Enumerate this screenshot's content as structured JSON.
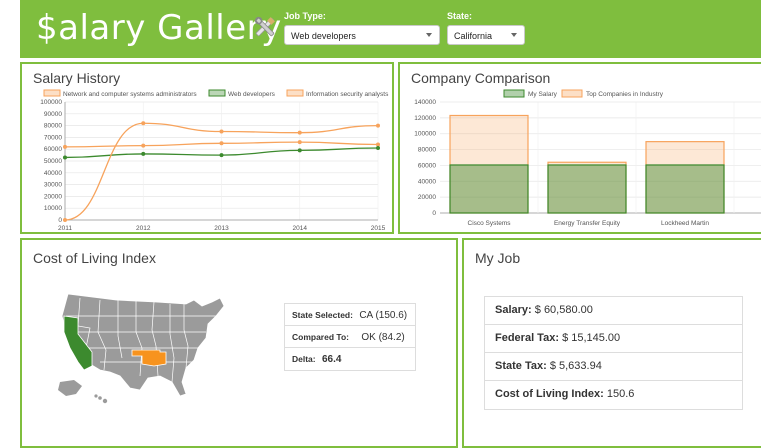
{
  "header": {
    "logo": "$alary Gallery",
    "job_type_label": "Job Type:",
    "job_type_value": "Web developers",
    "state_label": "State:",
    "state_value": "California"
  },
  "salary_history": {
    "title": "Salary History",
    "chart_data": {
      "type": "line",
      "x": [
        "2011",
        "2012",
        "2013",
        "2014",
        "2015"
      ],
      "ylim": [
        0,
        100000
      ],
      "yticks": [
        "100000",
        "90000",
        "80000",
        "70000",
        "60000",
        "50000",
        "40000",
        "30000",
        "20000",
        "10000",
        "0"
      ],
      "series": [
        {
          "name": "Network and computer systems administrators",
          "values": [
            62000,
            63000,
            65000,
            66000,
            64000
          ],
          "color": "#f7a35c"
        },
        {
          "name": "Web developers",
          "values": [
            53000,
            56000,
            55000,
            59000,
            61000
          ],
          "color": "#3c8a2e"
        },
        {
          "name": "Information security analysts",
          "values": [
            0,
            82000,
            75000,
            74000,
            80000
          ],
          "color": "#f7a35c"
        }
      ]
    }
  },
  "company_comparison": {
    "title": "Company Comparison",
    "chart_data": {
      "type": "bar",
      "categories": [
        "Cisco Systems",
        "Energy Transfer Equity",
        "Lockheed Martin"
      ],
      "ylim": [
        0,
        140000
      ],
      "yticks": [
        "140000",
        "120000",
        "100000",
        "80000",
        "60000",
        "40000",
        "20000",
        "0"
      ],
      "series": [
        {
          "name": "My Salary",
          "values": [
            60580,
            60580,
            60580
          ],
          "color": "#3c8a2e"
        },
        {
          "name": "Top Companies in Industry",
          "values": [
            123000,
            64000,
            90000
          ],
          "color": "#f7a35c"
        }
      ]
    }
  },
  "cost_of_living": {
    "title": "Cost of Living Index",
    "state_selected_label": "State Selected:",
    "state_selected_value": "CA (150.6)",
    "compared_to_label": "Compared To:",
    "compared_to_value": "OK (84.2)",
    "delta_label": "Delta:",
    "delta_value": "66.4",
    "colors": {
      "selected": "#3c8a2e",
      "compared": "#f7931e",
      "other": "#9b9b9b"
    }
  },
  "my_job": {
    "title": "My Job",
    "salary_label": "Salary:",
    "salary_value": "$ 60,580.00",
    "federal_label": "Federal Tax:",
    "federal_value": "$ 15,145.00",
    "state_label": "State Tax:",
    "state_value": "$ 5,633.94",
    "col_label": "Cost of Living Index:",
    "col_value": "150.6"
  }
}
